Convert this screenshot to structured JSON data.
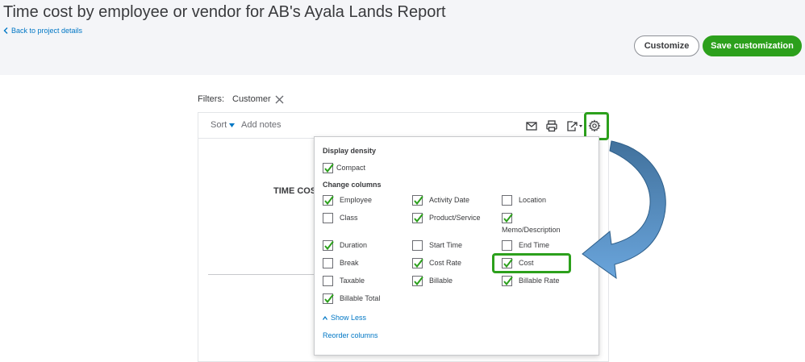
{
  "header": {
    "title": "Time cost by employee or vendor for AB's Ayala Lands Report",
    "back_link": "Back to project details",
    "customize_label": "Customize",
    "save_label": "Save customization"
  },
  "filters": {
    "label": "Filters:",
    "chip": "Customer"
  },
  "report": {
    "sort_label": "Sort",
    "add_notes_label": "Add notes",
    "title_fragment": "TIME COS"
  },
  "panel": {
    "display_density_heading": "Display density",
    "compact": {
      "label": "Compact",
      "checked": true
    },
    "change_columns_heading": "Change columns",
    "columns": [
      {
        "label": "Employee",
        "checked": true
      },
      {
        "label": "Activity Date",
        "checked": true
      },
      {
        "label": "Location",
        "checked": false
      },
      {
        "label": "Class",
        "checked": false
      },
      {
        "label": "Product/Service",
        "checked": true
      },
      {
        "label": "Memo/Description",
        "checked": true
      },
      {
        "label": "Duration",
        "checked": true
      },
      {
        "label": "Start Time",
        "checked": false
      },
      {
        "label": "End Time",
        "checked": false
      },
      {
        "label": "Break",
        "checked": false
      },
      {
        "label": "Cost Rate",
        "checked": true
      },
      {
        "label": "Cost",
        "checked": true
      },
      {
        "label": "Taxable",
        "checked": false
      },
      {
        "label": "Billable",
        "checked": true
      },
      {
        "label": "Billable Rate",
        "checked": true
      },
      {
        "label": "Billable Total",
        "checked": true
      }
    ],
    "show_less": "Show Less",
    "reorder": "Reorder columns"
  },
  "colors": {
    "accent_green": "#2ca01c",
    "link_blue": "#0077c5",
    "arrow_blue": "#5b9bd5"
  }
}
